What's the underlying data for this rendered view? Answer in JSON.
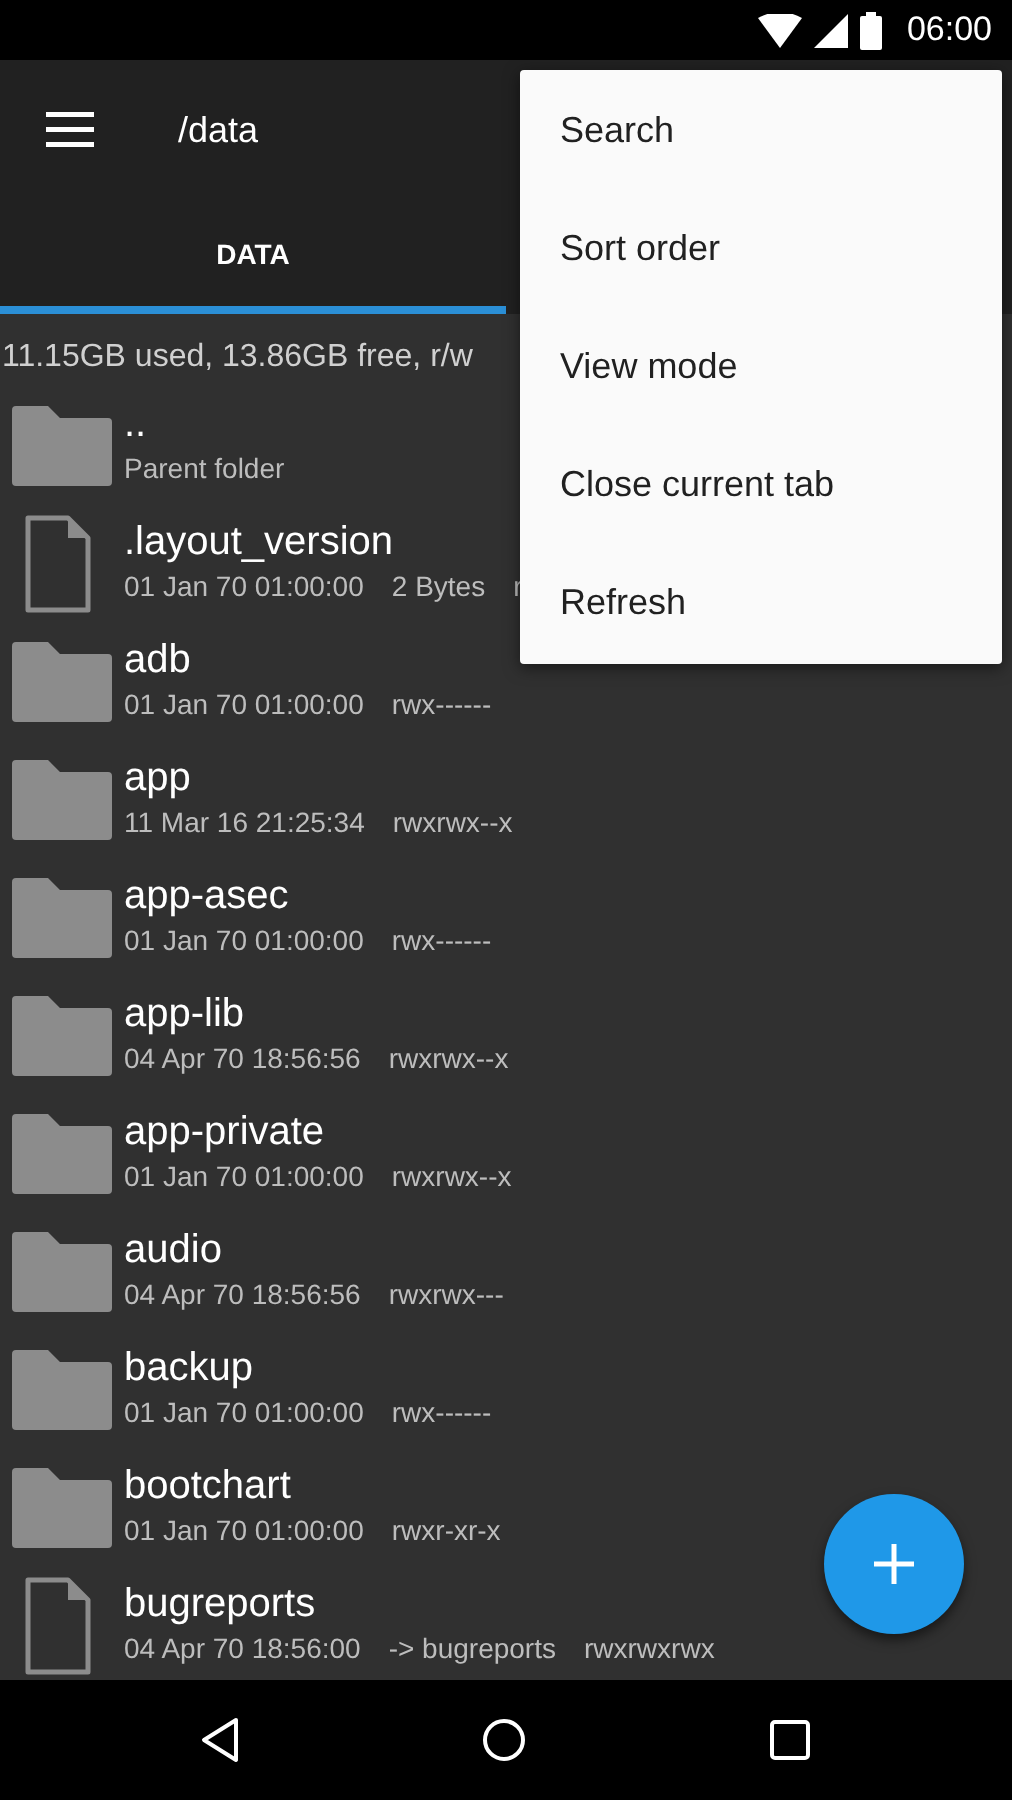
{
  "status_bar": {
    "time": "06:00"
  },
  "toolbar": {
    "path": "/data"
  },
  "tabs": [
    {
      "label": "DATA",
      "selected": true
    }
  ],
  "storage_info": "11.15GB used, 13.86GB free, r/w",
  "files": [
    {
      "kind": "parent",
      "name": "..",
      "subtitle": "Parent folder"
    },
    {
      "kind": "file",
      "name": ".layout_version",
      "date": "01 Jan 70 01:00:00",
      "detail": "2 Bytes",
      "permissions": "r"
    },
    {
      "kind": "folder",
      "name": "adb",
      "date": "01 Jan 70 01:00:00",
      "permissions": "rwx------"
    },
    {
      "kind": "folder",
      "name": "app",
      "date": "11 Mar 16 21:25:34",
      "permissions": "rwxrwx--x"
    },
    {
      "kind": "folder",
      "name": "app-asec",
      "date": "01 Jan 70 01:00:00",
      "permissions": "rwx------"
    },
    {
      "kind": "folder",
      "name": "app-lib",
      "date": "04 Apr 70 18:56:56",
      "permissions": "rwxrwx--x"
    },
    {
      "kind": "folder",
      "name": "app-private",
      "date": "01 Jan 70 01:00:00",
      "permissions": "rwxrwx--x"
    },
    {
      "kind": "folder",
      "name": "audio",
      "date": "04 Apr 70 18:56:56",
      "permissions": "rwxrwx---"
    },
    {
      "kind": "folder",
      "name": "backup",
      "date": "01 Jan 70 01:00:00",
      "permissions": "rwx------"
    },
    {
      "kind": "folder",
      "name": "bootchart",
      "date": "01 Jan 70 01:00:00",
      "permissions": "rwxr-xr-x"
    },
    {
      "kind": "file",
      "name": "bugreports",
      "date": "04 Apr 70 18:56:00",
      "detail": "-> bugreports",
      "permissions": "rwxrwxrwx"
    }
  ],
  "menu": {
    "items": [
      "Search",
      "Sort order",
      "View mode",
      "Close current tab",
      "Refresh"
    ]
  }
}
